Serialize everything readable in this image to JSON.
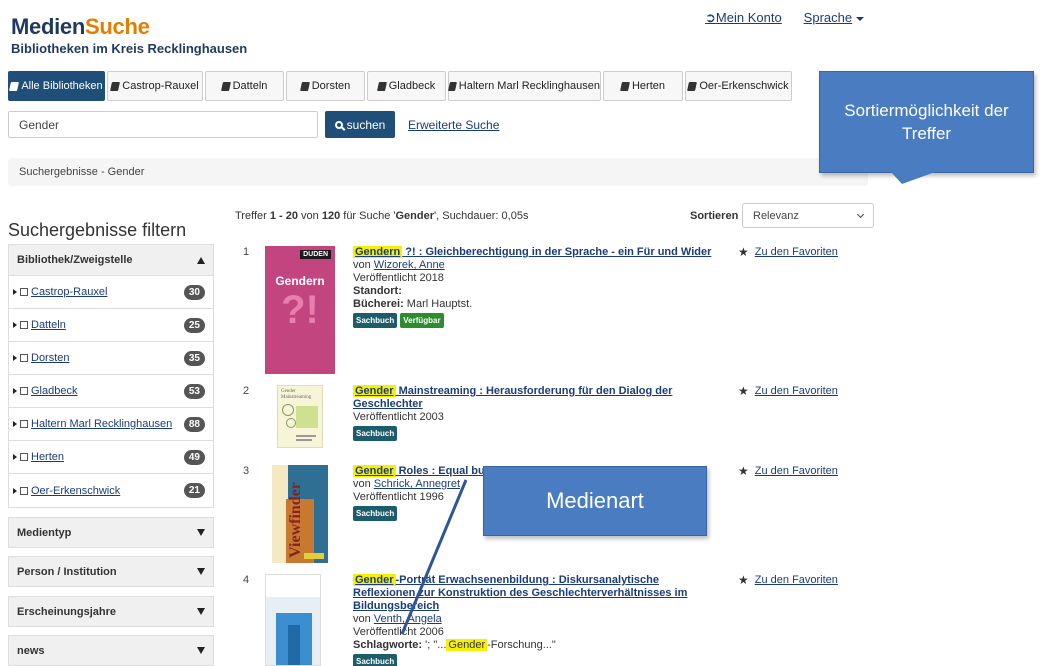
{
  "logo": {
    "title_main": "Medien",
    "title_accent": "Suche",
    "subtitle": "Bibliotheken im Kreis Recklinghausen"
  },
  "topnav": {
    "account": "Mein Konto",
    "language": "Sprache"
  },
  "tabs": [
    {
      "label": "Alle Bibliotheken",
      "active": true
    },
    {
      "label": "Castrop-Rauxel"
    },
    {
      "label": "Datteln"
    },
    {
      "label": "Dorsten"
    },
    {
      "label": "Gladbeck"
    },
    {
      "label": "Haltern Marl Recklinghausen"
    },
    {
      "label": "Herten"
    },
    {
      "label": "Oer-Erkenschwick"
    }
  ],
  "search": {
    "value": "Gender",
    "button": "suchen",
    "advanced": "Erweiterte Suche"
  },
  "breadcrumb": "Suchergebnisse - Gender",
  "sidebar": {
    "title": "Suchergebnisse filtern",
    "library_facet": {
      "heading": "Bibliothek/Zweigstelle",
      "items": [
        {
          "label": "Castrop-Rauxel",
          "count": "30"
        },
        {
          "label": "Datteln",
          "count": "25"
        },
        {
          "label": "Dorsten",
          "count": "35"
        },
        {
          "label": "Gladbeck",
          "count": "53"
        },
        {
          "label": "Haltern Marl Recklinghausen",
          "count": "88"
        },
        {
          "label": "Herten",
          "count": "49"
        },
        {
          "label": "Oer-Erkenschwick",
          "count": "21"
        }
      ]
    },
    "collapsed": [
      "Medientyp",
      "Person / Institution",
      "Erscheinungsjahre",
      "news"
    ]
  },
  "results_header": {
    "prefix": "Treffer ",
    "range": "1 - 20",
    "of": " von ",
    "total": "120",
    "for": " für Suche '",
    "query": "Gender",
    "suffix": "', Suchdauer: 0,05s",
    "sort_label": "Sortieren",
    "sort_value": "Relevanz"
  },
  "results": [
    {
      "num": "1",
      "hl": "Gendern",
      "title_rest": " ?! : Gleichberechtigung in der Sprache - ein Für und Wider",
      "by": "von ",
      "author": "Wizorek, Anne",
      "published": "Veröffentlicht 2018",
      "location_label": "Standort:",
      "branch_label": "Bücherei:",
      "branch": " Marl Hauptst.",
      "tags": [
        "Sachbuch",
        "Verfügbar"
      ],
      "fav": "Zu den Favoriten"
    },
    {
      "num": "2",
      "hl": "Gender",
      "title_rest": " Mainstreaming : Herausforderung für den Dialog der Geschlechter",
      "published": "Veröffentlicht 2003",
      "tags": [
        "Sachbuch"
      ],
      "fav": "Zu den Favoriten"
    },
    {
      "num": "3",
      "hl": "Gender",
      "title_rest": " Roles : Equal bu",
      "by": "von ",
      "author": "Schrick, Annegret",
      "published": "Veröffentlicht 1996",
      "tags": [
        "Sachbuch"
      ],
      "fav": "Zu den Favoriten"
    },
    {
      "num": "4",
      "hl": "Gender",
      "title_rest": "-Porträt Erwachsenenbildung : Diskursanalytische Reflexionen zur Konstruktion des Geschlechterverhältnisses im Bildungsbereich",
      "by": "von ",
      "author": "Venth, Angela",
      "published": "Veröffentlicht 2006",
      "keywords_label": "Schlagworte:",
      "keywords_pre": " '; \"...",
      "keywords_hl": "Gender",
      "keywords_post": "-Forschung...\"",
      "tags": [
        "Sachbuch"
      ],
      "fav": "Zu den Favoriten"
    }
  ],
  "callouts": {
    "sort": "Sortiermöglichkeit der Treffer",
    "media": "Medienart"
  },
  "covers": {
    "c1_publisher": "DUDEN",
    "c1_title": "Gendern",
    "c1_big": "?!",
    "c3_title": "Viewfinder"
  },
  "colors": {
    "brand": "#1f3a5f",
    "accent": "#e27f00",
    "primary": "#1f4e79",
    "highlight": "#f7f000",
    "callout": "#4a7cc1"
  }
}
